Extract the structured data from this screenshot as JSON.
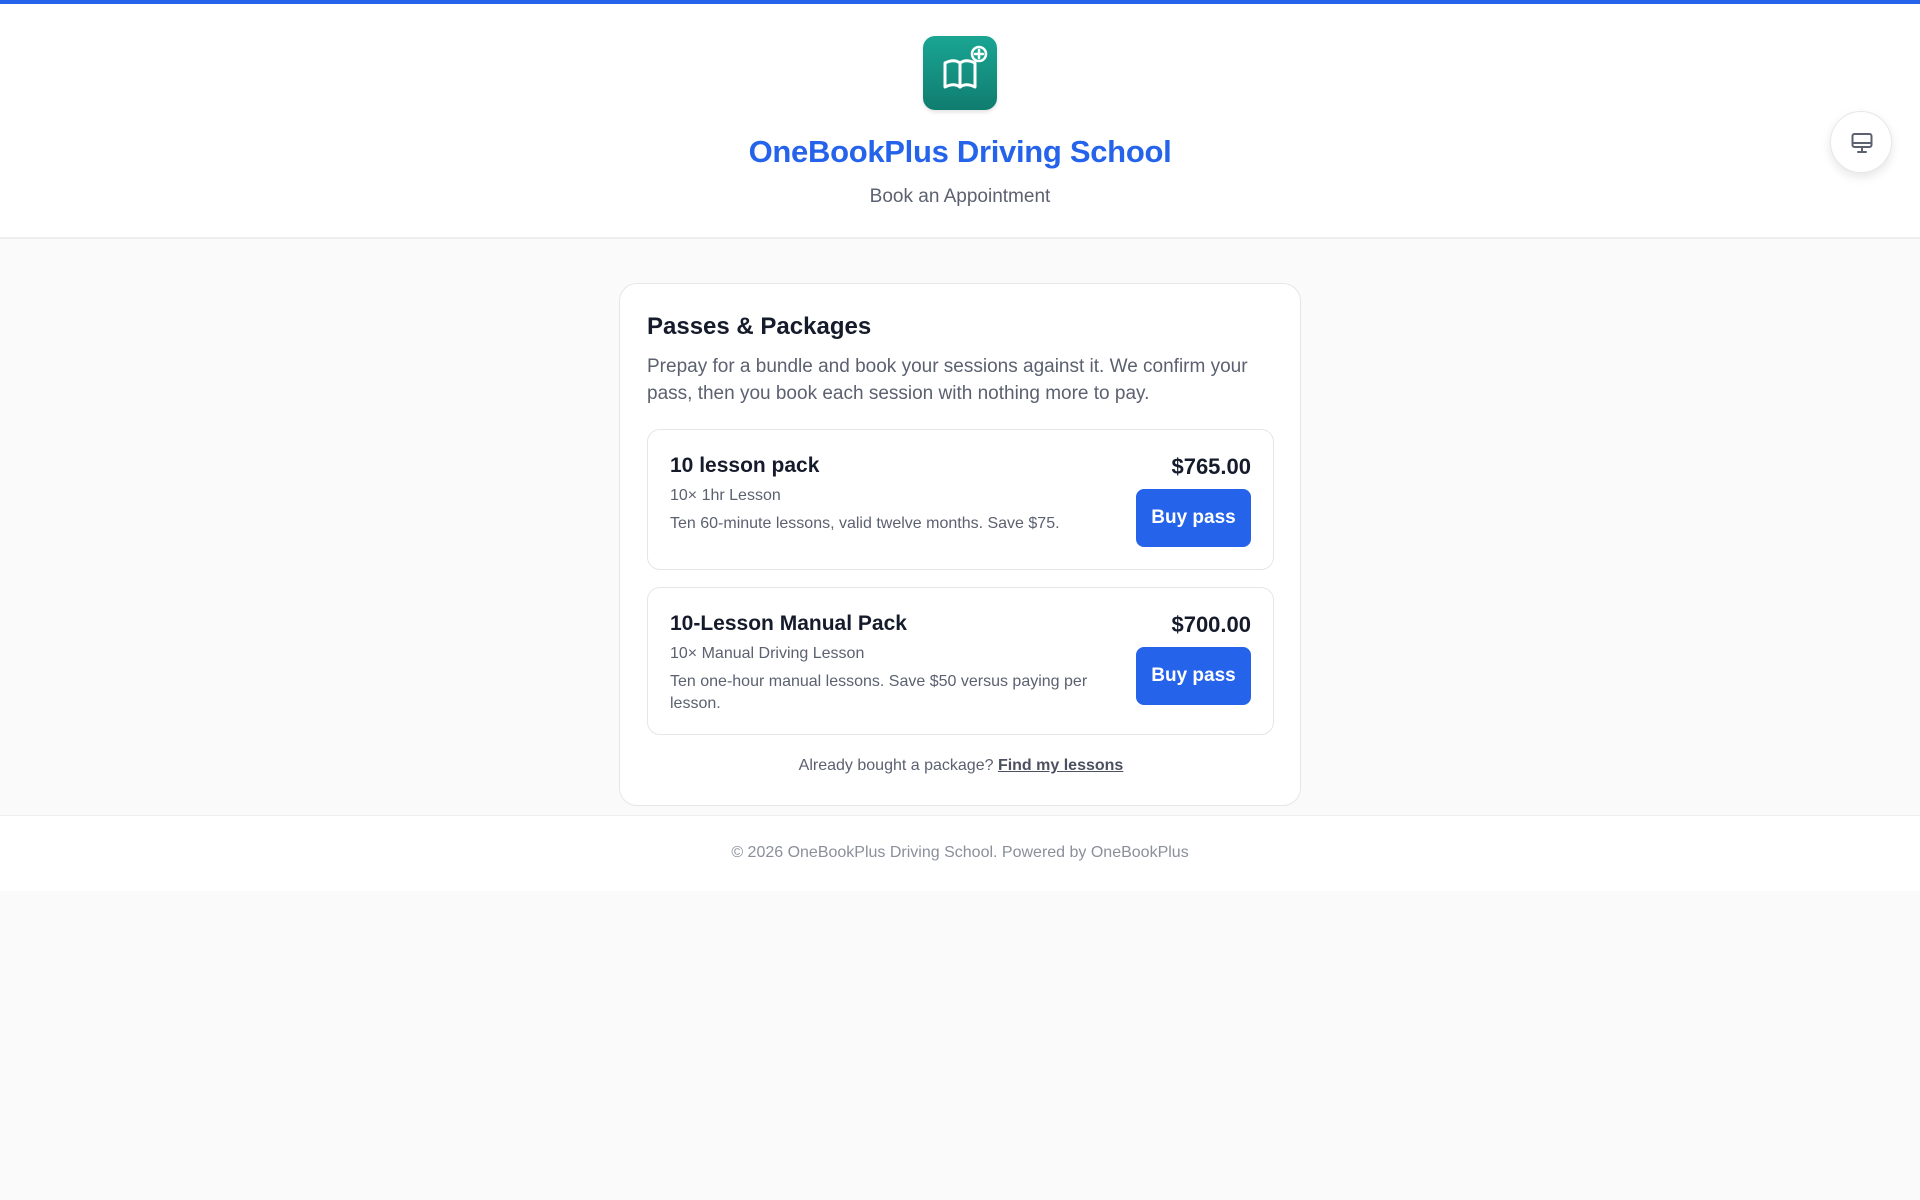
{
  "colors": {
    "accent": "#2563eb",
    "logo_gradient_top": "#1aa593",
    "logo_gradient_bottom": "#0f7d70",
    "text_primary": "#151b2b",
    "text_muted": "#5b6170",
    "page_background": "#fafafa"
  },
  "header": {
    "logo_icon": "open-book-plus-icon",
    "school_name": "OneBookPlus Driving School",
    "subtitle": "Book an Appointment",
    "display_toggle_icon": "monitor-icon"
  },
  "passes": {
    "title": "Passes & Packages",
    "description": "Prepay for a bundle and book your sessions against it. We confirm your pass, then you book each session with nothing more to pay.",
    "packages": [
      {
        "name": "10 lesson pack",
        "items": "10× 1hr Lesson",
        "description": "Ten 60-minute lessons, valid twelve months. Save $75.",
        "price": "$765.00",
        "button_label": "Buy pass"
      },
      {
        "name": "10-Lesson Manual Pack",
        "items": "10× Manual Driving Lesson",
        "description": "Ten one-hour manual lessons. Save $50 versus paying per lesson.",
        "price": "$700.00",
        "button_label": "Buy pass"
      }
    ],
    "already_text": "Already bought a package?",
    "find_link": "Find my lessons"
  },
  "footer": {
    "text": "© 2026 OneBookPlus Driving School. Powered by OneBookPlus"
  }
}
